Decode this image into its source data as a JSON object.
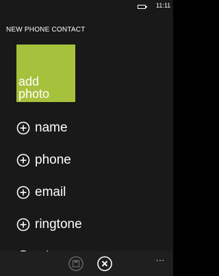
{
  "status": {
    "time": "11:11",
    "battery_icon": "battery-icon"
  },
  "page": {
    "title": "NEW PHONE CONTACT"
  },
  "photo": {
    "line1": "add",
    "line2": "photo",
    "color": "#a6c13c"
  },
  "fields": [
    {
      "label": "name",
      "icon": "add-circle-icon"
    },
    {
      "label": "phone",
      "icon": "add-circle-icon"
    },
    {
      "label": "email",
      "icon": "add-circle-icon"
    },
    {
      "label": "ringtone",
      "icon": "add-circle-icon"
    },
    {
      "label": "other",
      "icon": "add-circle-icon"
    }
  ],
  "app_bar": {
    "buttons": [
      {
        "icon": "save-icon",
        "enabled": false
      },
      {
        "icon": "cancel-icon",
        "enabled": true
      }
    ],
    "more": "..."
  }
}
